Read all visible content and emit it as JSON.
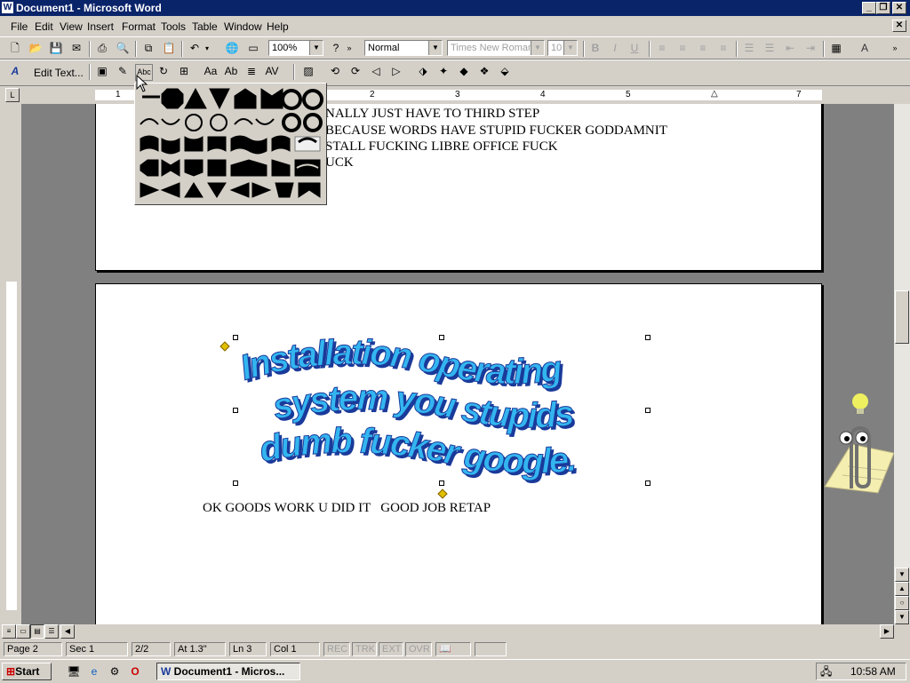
{
  "window": {
    "title": "Document1 - Microsoft Word"
  },
  "menubar": {
    "items": [
      "File",
      "Edit",
      "View",
      "Insert",
      "Format",
      "Tools",
      "Table",
      "Window",
      "Help"
    ]
  },
  "toolbar": {
    "zoom": "100%",
    "style": "Normal",
    "font": "Times New Roman",
    "size": "10"
  },
  "wordart_toolbar": {
    "edit_text_label": "Edit Text..."
  },
  "ruler": {
    "numbers": [
      "1",
      "2",
      "3",
      "4",
      "5",
      "7"
    ]
  },
  "document": {
    "page1_lines": [
      "NALLY JUST HAVE TO THIRD STEP",
      "BECAUSE WORDS HAVE STUPID FUCKER GODDAMNIT",
      "STALL FUCKING LIBRE OFFICE FUCK",
      "UCK"
    ],
    "wordart_lines": [
      "Installation operating",
      "system you stupids",
      "dumb fucker google."
    ],
    "page2_text": "OK GOODS WORK U DID IT   GOOD JOB RETAP"
  },
  "statusbar": {
    "page": "Page 2",
    "sec": "Sec 1",
    "pages": "2/2",
    "at": "At 1.3\"",
    "ln": "Ln 3",
    "col": "Col 1",
    "rec": "REC",
    "trk": "TRK",
    "ext": "EXT",
    "ovr": "OVR"
  },
  "taskbar": {
    "start": "Start",
    "task": "Document1 - Micros...",
    "clock": "10:58 AM"
  },
  "colors": {
    "titlebar": "#0a246a",
    "wordart_fill": "#33b5f0",
    "wordart_shadow": "#1a3a9a"
  }
}
